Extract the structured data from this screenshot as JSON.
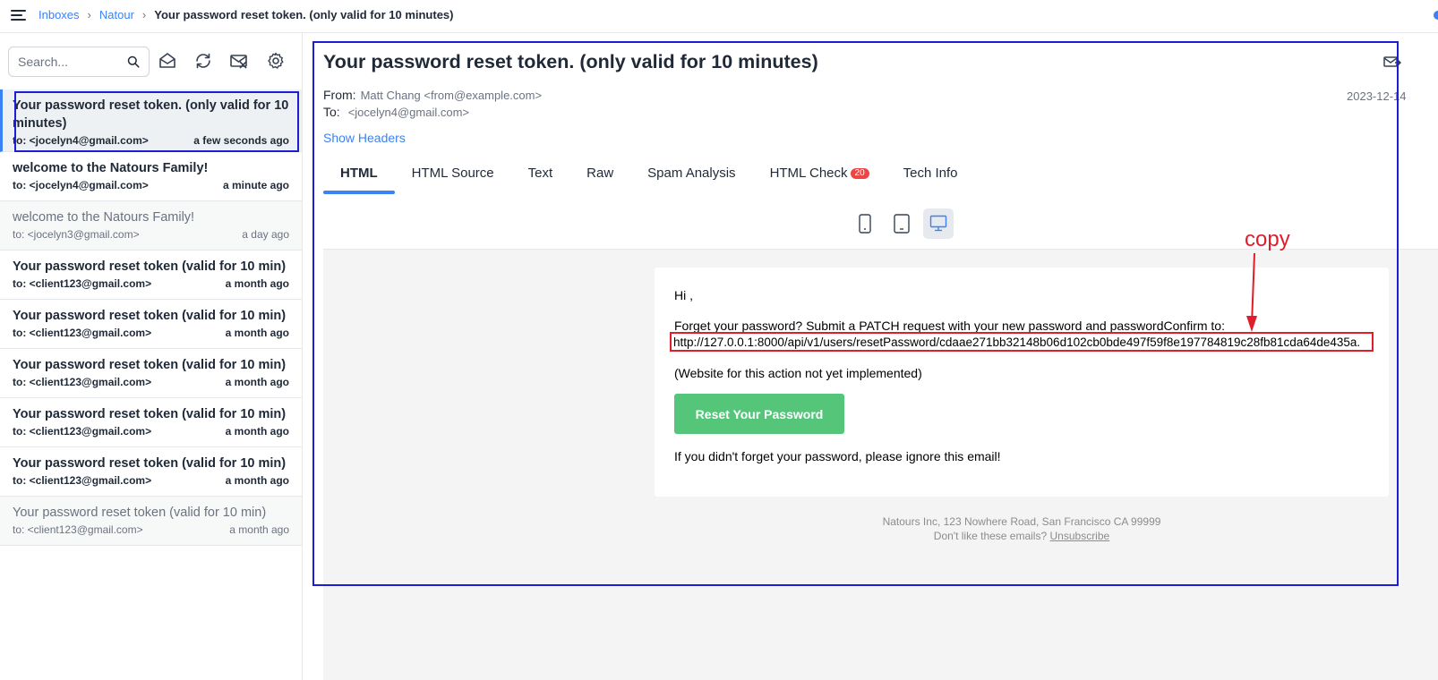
{
  "breadcrumb": {
    "items": [
      "Inboxes",
      "Natour"
    ],
    "separator": "›",
    "current": "Your password reset token. (only valid for 10 minutes)"
  },
  "sidebar": {
    "search_placeholder": "Search...",
    "messages": [
      {
        "subject": "Your password reset token. (only valid for 10 minutes)",
        "to": "to: <jocelyn4@gmail.com>",
        "time": "a few seconds ago",
        "state": "active"
      },
      {
        "subject": "welcome to the Natours Family!",
        "to": "to: <jocelyn4@gmail.com>",
        "time": "a minute ago",
        "state": "unread"
      },
      {
        "subject": "welcome to the Natours Family!",
        "to": "to: <jocelyn3@gmail.com>",
        "time": "a day ago",
        "state": "read"
      },
      {
        "subject": "Your password reset token (valid for 10 min)",
        "to": "to: <client123@gmail.com>",
        "time": "a month ago",
        "state": "unread"
      },
      {
        "subject": "Your password reset token (valid for 10 min)",
        "to": "to: <client123@gmail.com>",
        "time": "a month ago",
        "state": "unread"
      },
      {
        "subject": "Your password reset token (valid for 10 min)",
        "to": "to: <client123@gmail.com>",
        "time": "a month ago",
        "state": "unread"
      },
      {
        "subject": "Your password reset token (valid for 10 min)",
        "to": "to: <client123@gmail.com>",
        "time": "a month ago",
        "state": "unread"
      },
      {
        "subject": "Your password reset token (valid for 10 min)",
        "to": "to: <client123@gmail.com>",
        "time": "a month ago",
        "state": "unread"
      },
      {
        "subject": "Your password reset token (valid for 10 min)",
        "to": "to: <client123@gmail.com>",
        "time": "a month ago",
        "state": "read"
      }
    ]
  },
  "message": {
    "title": "Your password reset token. (only valid for 10 minutes)",
    "from_label": "From:",
    "from_value": "Matt Chang <from@example.com>",
    "to_label": "To:",
    "to_value": "<jocelyn4@gmail.com>",
    "date": "2023-12-14",
    "show_headers": "Show Headers"
  },
  "tabs": [
    {
      "label": "HTML",
      "active": true
    },
    {
      "label": "HTML Source"
    },
    {
      "label": "Text"
    },
    {
      "label": "Raw"
    },
    {
      "label": "Spam Analysis"
    },
    {
      "label": "HTML Check",
      "badge": "20"
    },
    {
      "label": "Tech Info"
    }
  ],
  "email": {
    "greeting": "Hi ,",
    "line1": "Forget your password? Submit a PATCH request with your new password and passwordConfirm to:",
    "url": "http://127.0.0.1:8000/api/v1/users/resetPassword/cdaae271bb32148b06d102cb0bde497f59f8e197784819c28fb81cda64de435a.",
    "note": "(Website for this action not yet implemented)",
    "button": "Reset Your Password",
    "closing": "If you didn't forget your password, please ignore this email!",
    "footer_address": "Natours Inc, 123 Nowhere Road, San Francisco CA 99999",
    "footer_prompt": "Don't like these emails?",
    "footer_unsubscribe": "Unsubscribe"
  },
  "annotation": {
    "label": "copy",
    "color": "#e11d2a"
  },
  "colors": {
    "accent": "#3b82f6",
    "button_green": "#55c57a",
    "highlight_blue": "#1d1dd6",
    "badge_red": "#ef4444"
  }
}
